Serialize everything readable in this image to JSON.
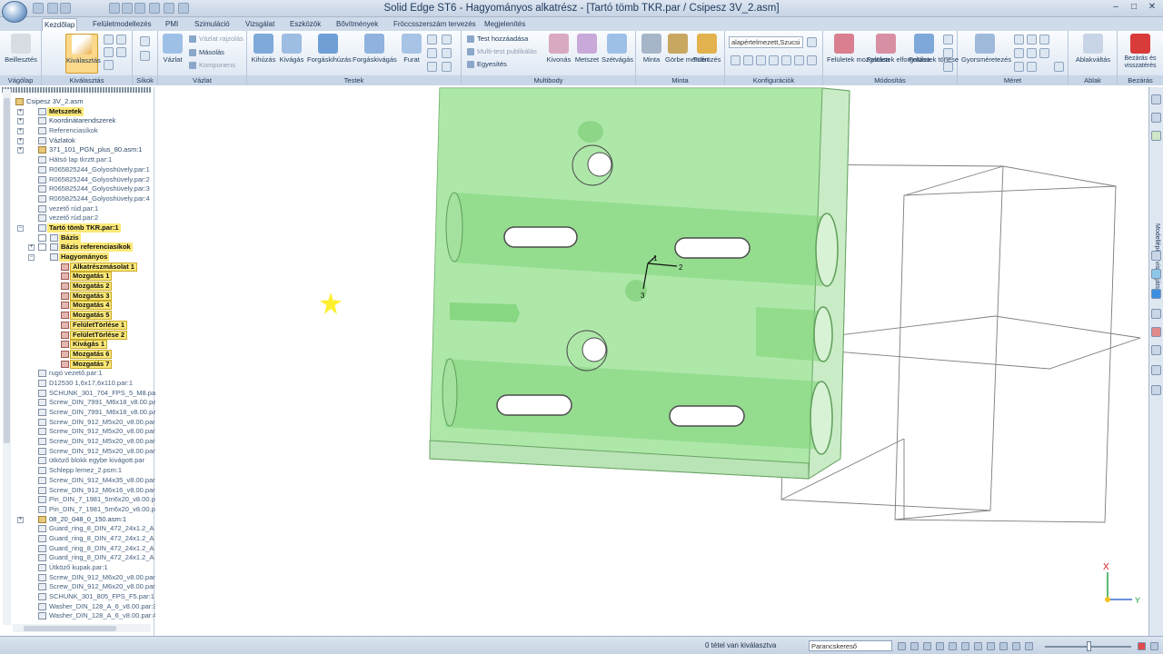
{
  "window": {
    "title": "Solid Edge ST6 - Hagyományos alkatrész - [Tartó tömb TKR.par / Csipesz 3V_2.asm]"
  },
  "tabs": [
    "Kezdőlap",
    "Felületmodellezés",
    "PMI",
    "Szimuláció",
    "Vizsgálat",
    "Eszközök",
    "Bővítmények",
    "Fröccsszerszám tervezés",
    "Megjelenítés"
  ],
  "ribbon": {
    "vagolap": {
      "label": "Vágólap",
      "beillesztes": "Beillesztés"
    },
    "kivalasztas": {
      "label": "Kiválasztás",
      "btn": "Kiválasztás"
    },
    "sikok": {
      "label": "Síkok"
    },
    "vazlat": {
      "label": "Vázlat",
      "btn": "Vázlat",
      "vazlat_rajzolas": "Vázlat rajzolás",
      "masolas": "Másolás",
      "komponens": "Komponens"
    },
    "testek": {
      "label": "Testek",
      "kihuzas": "Kihúzás",
      "kivagas": "Kivágás",
      "forgaskihuzas": "Forgáskihúzás",
      "forgaskivagas": "Forgáskivágás",
      "furat": "Furat"
    },
    "multibody": {
      "label": "Multibody",
      "test_hozzaadasa": "Test hozzáadása",
      "multitest_publikalas": "Multi-test publikálás",
      "egyesites": "Egyesítés",
      "kivonas": "Kivonás",
      "metszet": "Metszet",
      "szetvagas": "Szétvágás"
    },
    "minta": {
      "label": "Minta",
      "minta": "Minta",
      "gorbe_menten": "Görbe mentén",
      "tukrozes": "Tükrözés"
    },
    "konfiguraciok": {
      "label": "Konfigurációk",
      "combo": "alapértelmezett,Szucsi"
    },
    "modositas": {
      "label": "Módosítás",
      "felulet_mozgatasa": "Felületek mozgatása",
      "felulet_elforgatasa": "Felületek elforgatása",
      "felulet_torlese": "Felületek törlése"
    },
    "meret": {
      "label": "Méret",
      "gyorsmeretezes": "Gyorsméretezés"
    },
    "ablak": {
      "label": "Ablak",
      "ablakvaltas": "Ablakváltás"
    },
    "bezaras": {
      "label": "Bezárás",
      "btn": "Bezárás és visszatérés"
    }
  },
  "tree": [
    {
      "text": "Csipesz 3V_2.asm",
      "level": 0,
      "exp": "-",
      "type": "asm"
    },
    {
      "text": "Metszetek",
      "level": 1,
      "exp": "+",
      "type": "hl"
    },
    {
      "text": "Koordinátarendszerek",
      "level": 1,
      "exp": "+",
      "type": "node"
    },
    {
      "text": "Referenciasíkok",
      "level": 1,
      "exp": "+",
      "type": "grey"
    },
    {
      "text": "Vázlatok",
      "level": 1,
      "exp": "+",
      "type": "node"
    },
    {
      "text": "371_101_PGN_plus_80.asm:1",
      "level": 1,
      "exp": "+",
      "type": "asm"
    },
    {
      "text": "Hátsó lap tkrztt.par:1",
      "level": 1,
      "exp": "",
      "type": "grey"
    },
    {
      "text": "R065825244_Golyoshüvely.par:1",
      "level": 1,
      "exp": "",
      "type": "grey"
    },
    {
      "text": "R065825244_Golyoshüvely.par:2",
      "level": 1,
      "exp": "",
      "type": "grey"
    },
    {
      "text": "R065825244_Golyoshüvely.par:3",
      "level": 1,
      "exp": "",
      "type": "grey"
    },
    {
      "text": "R065825244_Golyoshüvely.par:4",
      "level": 1,
      "exp": "",
      "type": "grey"
    },
    {
      "text": "vezető rúd.par:1",
      "level": 1,
      "exp": "",
      "type": "grey"
    },
    {
      "text": "vezető rúd.par:2",
      "level": 1,
      "exp": "",
      "type": "grey"
    },
    {
      "text": "Tartó tömb TKR.par:1",
      "level": 1,
      "exp": "-",
      "type": "hl"
    },
    {
      "text": "Bázis",
      "level": 2,
      "exp": "",
      "type": "hl"
    },
    {
      "text": "Bázis referenciasíkok",
      "level": 2,
      "exp": "+",
      "type": "hl"
    },
    {
      "text": "Hagyományos",
      "level": 2,
      "exp": "-",
      "type": "hl"
    },
    {
      "text": "Alkatrészmásolat 1",
      "level": 3,
      "exp": "",
      "type": "feat"
    },
    {
      "text": "Mozgatás 1",
      "level": 3,
      "exp": "",
      "type": "feat"
    },
    {
      "text": "Mozgatás 2",
      "level": 3,
      "exp": "",
      "type": "feat"
    },
    {
      "text": "Mozgatás 3",
      "level": 3,
      "exp": "",
      "type": "feat"
    },
    {
      "text": "Mozgatás 4",
      "level": 3,
      "exp": "",
      "type": "feat"
    },
    {
      "text": "Mozgatás 5",
      "level": 3,
      "exp": "",
      "type": "feat"
    },
    {
      "text": "FelületTörlése 1",
      "level": 3,
      "exp": "",
      "type": "feat"
    },
    {
      "text": "FelületTörlése 2",
      "level": 3,
      "exp": "",
      "type": "feat"
    },
    {
      "text": "Kivágás 1",
      "level": 3,
      "exp": "",
      "type": "feat"
    },
    {
      "text": "Mozgatás 6",
      "level": 3,
      "exp": "",
      "type": "feat"
    },
    {
      "text": "Mozgatás 7",
      "level": 3,
      "exp": "",
      "type": "feat"
    },
    {
      "text": "rugó vezető.par:1",
      "level": 1,
      "exp": "",
      "type": "grey"
    },
    {
      "text": "D12530 1,6x17,6x110.par:1",
      "level": 1,
      "exp": "",
      "type": "grey"
    },
    {
      "text": "SCHUNK_301_704_FPS_5_M8.par:",
      "level": 1,
      "exp": "",
      "type": "grey"
    },
    {
      "text": "Screw_DIN_7991_M6x18_v8.00.par",
      "level": 1,
      "exp": "",
      "type": "grey"
    },
    {
      "text": "Screw_DIN_7991_M6x18_v8.00.par",
      "level": 1,
      "exp": "",
      "type": "grey"
    },
    {
      "text": "Screw_DIN_912_M5x20_v8.00.par",
      "level": 1,
      "exp": "",
      "type": "grey"
    },
    {
      "text": "Screw_DIN_912_M5x20_v8.00.par",
      "level": 1,
      "exp": "",
      "type": "grey"
    },
    {
      "text": "Screw_DIN_912_M5x20_v8.00.par",
      "level": 1,
      "exp": "",
      "type": "grey"
    },
    {
      "text": "Screw_DIN_912_M5x20_v8.00.par",
      "level": 1,
      "exp": "",
      "type": "grey"
    },
    {
      "text": "ütköző blokk egybe kivágott.par",
      "level": 1,
      "exp": "",
      "type": "grey"
    },
    {
      "text": "Schlepp lemez_2.psm:1",
      "level": 1,
      "exp": "",
      "type": "grey"
    },
    {
      "text": "Screw_DIN_912_M4x35_v8.00.par",
      "level": 1,
      "exp": "",
      "type": "grey"
    },
    {
      "text": "Screw_DIN_912_M6x16_v8.00.par",
      "level": 1,
      "exp": "",
      "type": "grey"
    },
    {
      "text": "Pin_DIN_7_1981_5m6x20_v8.00.pa",
      "level": 1,
      "exp": "",
      "type": "grey"
    },
    {
      "text": "Pin_DIN_7_1981_5m6x20_v8.00.pa",
      "level": 1,
      "exp": "",
      "type": "grey"
    },
    {
      "text": "08_20_048_0_150.asm:1",
      "level": 1,
      "exp": "+",
      "type": "asm"
    },
    {
      "text": "Guard_ring_8_DIN_472_24x1.2_A",
      "level": 1,
      "exp": "",
      "type": "grey"
    },
    {
      "text": "Guard_ring_8_DIN_472_24x1.2_A",
      "level": 1,
      "exp": "",
      "type": "grey"
    },
    {
      "text": "Guard_ring_8_DIN_472_24x1.2_A",
      "level": 1,
      "exp": "",
      "type": "grey"
    },
    {
      "text": "Guard_ring_8_DIN_472_24x1.2_A",
      "level": 1,
      "exp": "",
      "type": "grey"
    },
    {
      "text": "Ütköző kupak.par:1",
      "level": 1,
      "exp": "",
      "type": "grey"
    },
    {
      "text": "Screw_DIN_912_M6x20_v8.00.par",
      "level": 1,
      "exp": "",
      "type": "grey"
    },
    {
      "text": "Screw_DIN_912_M6x20_v8.00.par",
      "level": 1,
      "exp": "",
      "type": "grey"
    },
    {
      "text": "SCHUNK_301_805_FPS_F5.par:1",
      "level": 1,
      "exp": "",
      "type": "grey"
    },
    {
      "text": "Washer_DIN_128_A_6_v8.00.par:3",
      "level": 1,
      "exp": "",
      "type": "grey"
    },
    {
      "text": "Washer_DIN_128_A_6_v8.00.par:4",
      "level": 1,
      "exp": "",
      "type": "grey"
    }
  ],
  "viewport": {
    "triad_labels": {
      "x": "1",
      "y": "2",
      "z": "3"
    },
    "view_axes": {
      "x": "X",
      "y": "Y"
    }
  },
  "right_strip": {
    "vertical_label": "Modellépítés visszajátszás"
  },
  "status": {
    "message": "0 tétel van kiválasztva",
    "command_finder": "Parancskereső"
  },
  "colors": {
    "part_fill": "#8fe08a",
    "selection": "#fbe878",
    "ribbon_bg": "#e3ebf5"
  }
}
